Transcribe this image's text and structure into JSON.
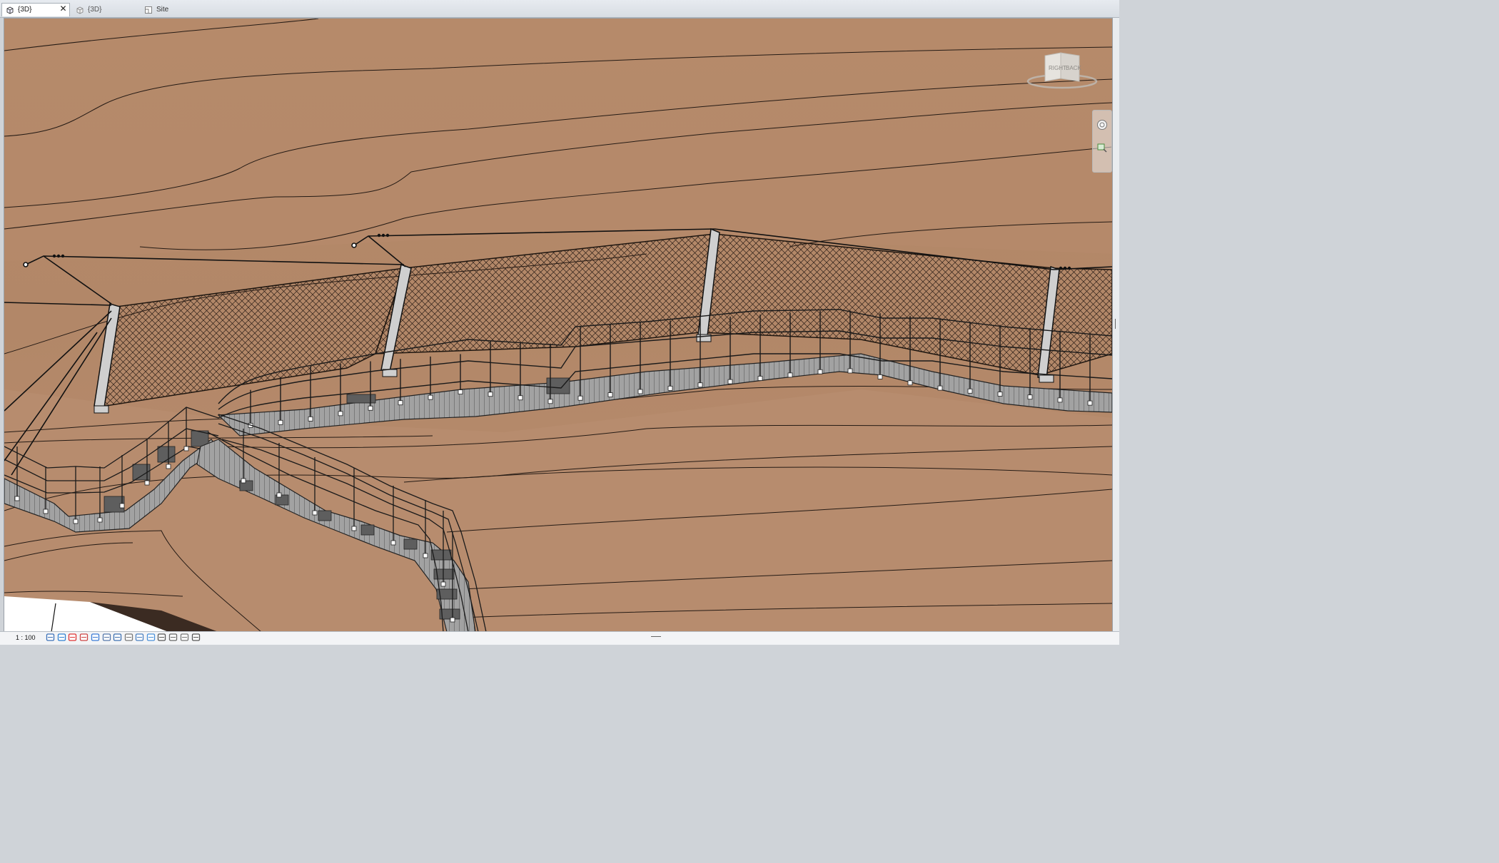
{
  "tabs": [
    {
      "label": "{3D}",
      "icon": "3d-view-icon",
      "active": true,
      "closable": true
    },
    {
      "label": "{3D}",
      "icon": "3d-view-icon",
      "active": false
    },
    {
      "label": "Site",
      "icon": "floor-plan-icon",
      "active": false
    }
  ],
  "viewcube": {
    "faces": [
      "RIGHT",
      "BACK"
    ]
  },
  "navigation_bar": {
    "tools": [
      "steering-wheel-icon",
      "zoom-region-icon"
    ]
  },
  "status": {
    "scale": "1 : 100",
    "view_control_icons": [
      "detail-level-icon",
      "visual-style-icon",
      "sun-path-icon",
      "shadows-icon",
      "crop-view-icon",
      "show-crop-region-icon",
      "unlock-3d-view-icon",
      "temporary-hide-icon",
      "reveal-hidden-icon",
      "analytical-model-icon",
      "highlight-displacement-icon",
      "render-icon",
      "worksharing-icon",
      "constraints-icon"
    ]
  },
  "colors": {
    "terrain": "#b48a6c",
    "stair_concrete": "#9e9e9e",
    "mesh": "#3a2a20",
    "railing": "#2a2a2a"
  }
}
